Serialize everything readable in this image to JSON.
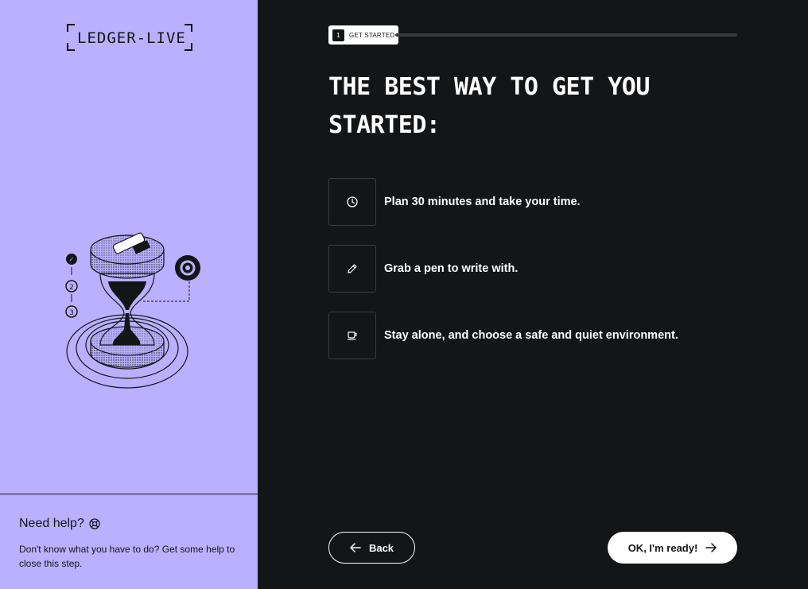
{
  "logo": {
    "text": "LEDGER-LIVE"
  },
  "help": {
    "title": "Need help?",
    "description": "Don't know what you have to do? Get some help to close this step.",
    "icon": "lifebuoy-icon"
  },
  "stepper": {
    "number": "1",
    "label": "GET STARTED",
    "progress": 0
  },
  "heading": "THE BEST WAY TO GET YOU STARTED:",
  "tips": [
    {
      "icon": "clock-icon",
      "text": "Plan 30 minutes and take your time."
    },
    {
      "icon": "pen-icon",
      "text": "Grab a pen to write with."
    },
    {
      "icon": "coffee-cup-icon",
      "text": "Stay alone, and choose a safe and quiet environment."
    }
  ],
  "buttons": {
    "back": "Back",
    "ready": "OK, I'm ready!"
  },
  "colors": {
    "left_panel": "#bbb0ff",
    "background": "#141516",
    "text_light": "#ffffff"
  }
}
